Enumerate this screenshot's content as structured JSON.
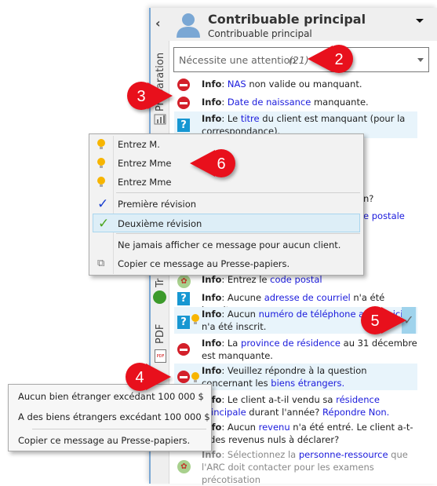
{
  "header": {
    "title": "Contribuable principal",
    "subtitle": "Contribuable principal"
  },
  "filter": {
    "label": "Nécessite une attention",
    "count": "(21)"
  },
  "rail": {
    "tabs": [
      "Préparation",
      "Tr",
      "PDF"
    ]
  },
  "rows": [
    {
      "icon": "stop",
      "parts": [
        [
          "b",
          "Info"
        ],
        [
          "t",
          ": "
        ],
        [
          "l",
          "NAS"
        ],
        [
          "t",
          " non valide ou manquant."
        ]
      ]
    },
    {
      "icon": "stop",
      "parts": [
        [
          "b",
          "Info"
        ],
        [
          "t",
          ": "
        ],
        [
          "l",
          "Date de naissance"
        ],
        [
          "t",
          " manquante."
        ]
      ]
    },
    {
      "icon": "question",
      "hl": true,
      "parts": [
        [
          "b",
          "Info"
        ],
        [
          "t",
          ": Le "
        ],
        [
          "l",
          "titre"
        ],
        [
          "t",
          " du client est manquant (pour la correspondance)."
        ]
      ]
    },
    {
      "icon": "maple",
      "parts": [
        [
          "b",
          "Info"
        ],
        [
          "t",
          ": Entrez le "
        ],
        [
          "l",
          "code postal"
        ]
      ]
    },
    {
      "icon": "question",
      "parts": [
        [
          "b",
          "Info"
        ],
        [
          "t",
          ": Aucune "
        ],
        [
          "l",
          "adresse de courriel"
        ],
        [
          "t",
          " n'a été inscrite."
        ]
      ]
    },
    {
      "icon": "question-bulb",
      "hl": true,
      "parts": [
        [
          "b",
          "Info"
        ],
        [
          "t",
          ": Aucun "
        ],
        [
          "l",
          "numéro de téléphone au domicile"
        ],
        [
          "t",
          " n'a été inscrit."
        ]
      ]
    },
    {
      "icon": "stop",
      "parts": [
        [
          "b",
          "Info"
        ],
        [
          "t",
          ": La "
        ],
        [
          "l",
          "province de résidence"
        ],
        [
          "t",
          " au 31 décembre est manquante."
        ]
      ]
    },
    {
      "icon": "stop-bulb",
      "hl": true,
      "parts": [
        [
          "b",
          "Info"
        ],
        [
          "t",
          ": Veuillez répondre à la question concernant les "
        ],
        [
          "l",
          "biens étrangers."
        ]
      ]
    },
    {
      "icon": "none",
      "parts": [
        [
          "b",
          "Info"
        ],
        [
          "t",
          ": Le client a-t-il vendu sa "
        ],
        [
          "l",
          "résidence principale"
        ],
        [
          "t",
          " durant l'année? "
        ],
        [
          "l",
          "Répondre Non."
        ]
      ]
    },
    {
      "icon": "none",
      "parts": [
        [
          "b",
          "Info"
        ],
        [
          "t",
          ": Aucun "
        ],
        [
          "l",
          "revenu"
        ],
        [
          "t",
          " n'a été entré. Le client a-t-il des revenus nuls à déclarer?"
        ]
      ]
    },
    {
      "icon": "maple",
      "parts": [
        [
          "b",
          "Info"
        ],
        [
          "t",
          ": Sélectionnez la "
        ],
        [
          "l",
          "personne-ressource"
        ],
        [
          "t",
          " que l'ARC doit contacter pour les examens précotisation"
        ]
      ]
    }
  ],
  "hidden_fragments": [
    "t.",
    "n?",
    "e postale"
  ],
  "context_menu_title": {
    "items": [
      {
        "icon": "bulb",
        "label": "Entrez M."
      },
      {
        "icon": "bulb",
        "label": "Entrez Mme"
      },
      {
        "icon": "bulb",
        "label": "Entrez Mme"
      },
      {
        "icon": "check-blue",
        "label": "Première révision"
      },
      {
        "icon": "check-green",
        "label": "Deuxième révision",
        "highlighted": true
      },
      {
        "icon": "none",
        "label": "Ne jamais afficher ce message pour aucun client."
      },
      {
        "icon": "copy",
        "label": "Copier ce message au Presse-papiers."
      }
    ]
  },
  "context_menu_foreign": {
    "items": [
      {
        "label": "Aucun bien étranger excédant 100 000 $"
      },
      {
        "label": "A des biens étrangers excédant 100 000 $"
      },
      {
        "label": "Copier ce message au Presse-papiers."
      }
    ]
  },
  "callouts": [
    "2",
    "3",
    "4",
    "5",
    "6"
  ],
  "colors": {
    "callout": "#e8101c",
    "link": "#1a1adc",
    "highlight": "#e8f4fb",
    "stop": "#d3202a",
    "question": "#1797d2"
  }
}
